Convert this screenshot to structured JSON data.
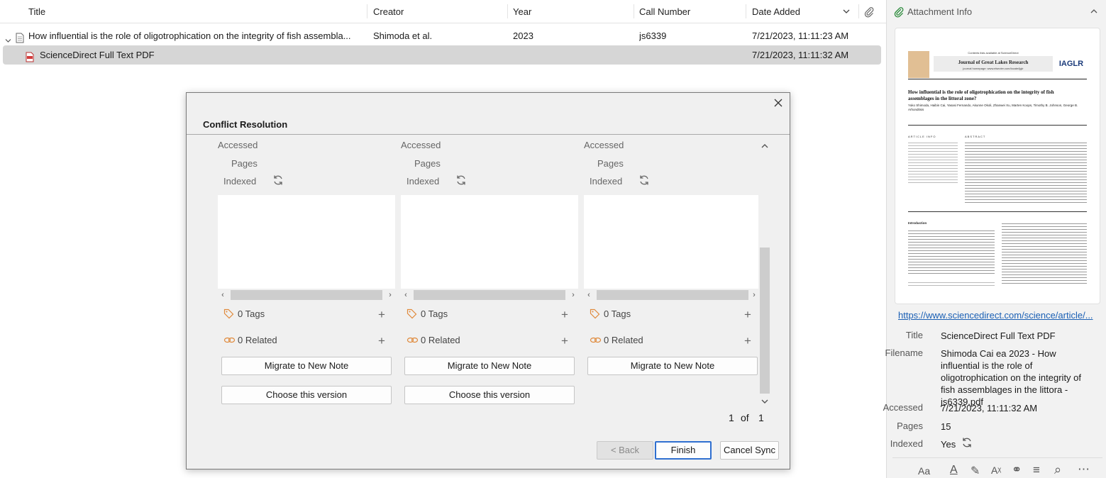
{
  "items_pane": {
    "columns": {
      "title": "Title",
      "creator": "Creator",
      "year": "Year",
      "call_number": "Call Number",
      "date_added": "Date Added"
    },
    "rows": [
      {
        "title": "How influential is the role of oligotrophication on the integrity of fish assembla...",
        "creator": "Shimoda et al.",
        "year": "2023",
        "call_number": "js6339",
        "date_added": "7/21/2023, 11:11:23 AM"
      },
      {
        "title": "ScienceDirect Full Text PDF",
        "date_added": "7/21/2023, 11:11:32 AM"
      }
    ]
  },
  "right_pane": {
    "header": "Attachment Info",
    "preview": {
      "journal_header": "Journal of Great Lakes Research",
      "contents_line": "Contents lists available at ScienceDirect",
      "homepage": "journal homepage: www.elsevier.com/locate/ijglr",
      "logo": "IAGLR",
      "article_title": "How influential is the role of oligotrophication on the integrity of fish assemblages in the littoral zone?",
      "authors": "Yuko Shimoda, Haibin Cai, Yasasi Fernando, Akunne Okoli, Zhanwei Xu, Marten Koops, Timothy B. Johnson, George B. Arhonditsis",
      "section_info": "ARTICLE INFO",
      "section_abstract": "ABSTRACT",
      "section_intro": "Introduction"
    },
    "url": "https://www.sciencedirect.com/science/article/...",
    "fields": [
      {
        "label": "Title",
        "value": "ScienceDirect Full Text PDF"
      },
      {
        "label": "Filename",
        "value": "Shimoda Cai ea 2023 - How influential is the role of oligotrophication on the integrity of fish assemblages in the littora - js6339.pdf"
      },
      {
        "label": "Accessed",
        "value": "7/21/2023, 11:11:32 AM"
      },
      {
        "label": "Pages",
        "value": "15"
      },
      {
        "label": "Indexed",
        "value": "Yes"
      }
    ],
    "toolbar_icons": [
      "font-size-icon",
      "text-color-icon",
      "highlight-icon",
      "clear-format-icon",
      "link-icon",
      "insert-list-icon",
      "find-icon",
      "more-icon"
    ],
    "toolbar_glyphs": [
      "Aa",
      "A",
      "✎",
      "Aᵡ",
      "⚭",
      "≡",
      "⌕",
      "⋯"
    ]
  },
  "dialog": {
    "title": "Conflict Resolution",
    "panes": [
      {
        "accessed": "Accessed",
        "pages": "Pages",
        "indexed": "Indexed",
        "tags": "0 Tags",
        "related": "0 Related",
        "migrate": "Migrate to New Note",
        "choose": "Choose this version"
      },
      {
        "accessed": "Accessed",
        "pages": "Pages",
        "indexed": "Indexed",
        "tags": "0 Tags",
        "related": "0 Related",
        "migrate": "Migrate to New Note",
        "choose": "Choose this version"
      },
      {
        "accessed": "Accessed",
        "pages": "Pages",
        "indexed": "Indexed",
        "tags": "0 Tags",
        "related": "0 Related",
        "migrate": "Migrate to New Note"
      }
    ],
    "pagination": {
      "current": "1",
      "of": "of",
      "total": "1"
    },
    "buttons": {
      "back": "< Back",
      "finish": "Finish",
      "cancel": "Cancel Sync"
    }
  }
}
